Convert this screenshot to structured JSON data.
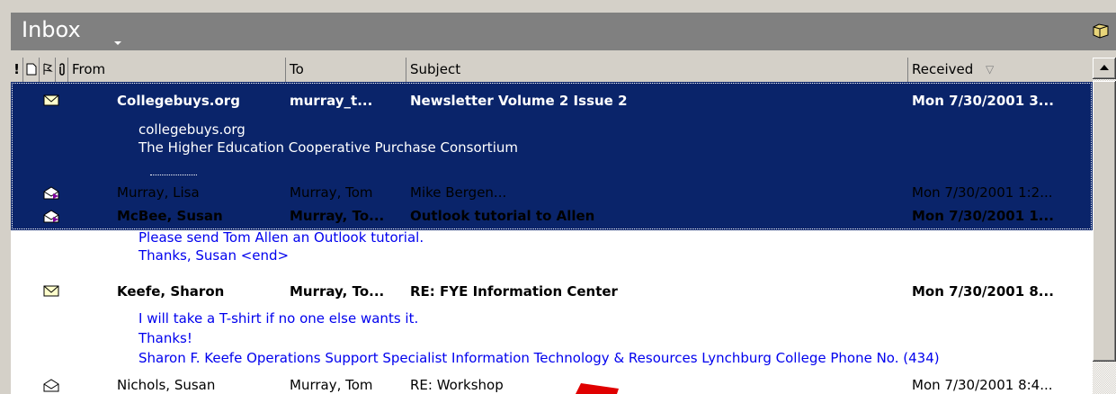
{
  "folder": {
    "title": "Inbox"
  },
  "columns": {
    "importance": "!",
    "from": "From",
    "to": "To",
    "subject": "Subject",
    "received": "Received"
  },
  "messages": [
    {
      "icon": "envelope-unread-icon",
      "from": "Collegebuys.org",
      "to": "murray_t...",
      "subject": "Newsletter Volume 2 Issue 2",
      "received": "Mon 7/30/2001 3...",
      "unread": true,
      "selected": true,
      "preview": [
        "collegebuys.org",
        "The Higher Education Cooperative Purchase Consortium"
      ]
    },
    {
      "icon": "envelope-read-icon",
      "from": "Murray, Lisa",
      "to": "Murray, Tom",
      "subject": "Mike Bergen...",
      "received": "Mon 7/30/2001 1:2...",
      "unread": false,
      "preview": []
    },
    {
      "icon": "envelope-read-icon",
      "from": "McBee, Susan",
      "to": "Murray, To...",
      "subject": "Outlook tutorial to Allen",
      "received": "Mon 7/30/2001 1...",
      "unread": true,
      "preview": [
        "Please send Tom Allen an Outlook tutorial.",
        "Thanks, Susan <end>"
      ]
    },
    {
      "icon": "envelope-unread-icon",
      "from": "Keefe, Sharon",
      "to": "Murray, To...",
      "subject": "RE: FYE Information Center",
      "received": "Mon 7/30/2001 8...",
      "unread": true,
      "preview": [
        "I will take a T-shirt if no one else wants it.",
        "Thanks!",
        "Sharon F. Keefe Operations Support Specialist Information Technology & Resources Lynchburg College Phone No. (434)"
      ]
    },
    {
      "icon": "envelope-open-icon",
      "from": "Nichols, Susan",
      "to": "Murray, Tom",
      "subject": "RE: Workshop",
      "received": "Mon 7/30/2001 8:4...",
      "unread": false,
      "preview": []
    }
  ],
  "colors": {
    "selection": "#0a246a",
    "preview": "#0000ee",
    "header": "#808080"
  }
}
